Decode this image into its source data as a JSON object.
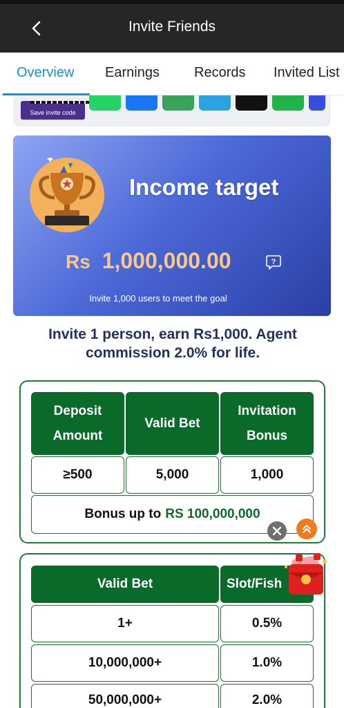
{
  "header": {
    "title": "Invite Friends"
  },
  "tabs": [
    {
      "label": "Overview",
      "active": true
    },
    {
      "label": "Earnings",
      "active": false
    },
    {
      "label": "Records",
      "active": false
    },
    {
      "label": "Invited List",
      "active": false
    }
  ],
  "share": {
    "save_code_label": "Save invite code",
    "buttons": [
      {
        "name": "whatsapp",
        "color": "#25d366"
      },
      {
        "name": "facebook",
        "color": "#1877f2"
      },
      {
        "name": "line",
        "color": "#3aa35a"
      },
      {
        "name": "telegram",
        "color": "#2aa3e0"
      },
      {
        "name": "x",
        "color": "#111111"
      },
      {
        "name": "message",
        "color": "#1fb34a"
      },
      {
        "name": "more",
        "color": "#3a4be0"
      }
    ]
  },
  "income": {
    "title": "Income target",
    "currency": "Rs",
    "amount": "1,000,000.00",
    "subtitle": "Invite 1,000 users to meet the goal"
  },
  "headline": "Invite 1 person, earn Rs1,000. Agent commission 2.0% for life.",
  "invite_table": {
    "headers": [
      "Deposit Amount",
      "Valid Bet",
      "Invitation Bonus"
    ],
    "row": [
      "≥500",
      "5,000",
      "1,000"
    ],
    "bonus_prefix": "Bonus up to",
    "bonus_value": "RS 100,000,000"
  },
  "commission_table": {
    "headers": [
      "Valid Bet",
      "Slot/Fish"
    ],
    "rows": [
      [
        "1+",
        "0.5%"
      ],
      [
        "10,000,000+",
        "1.0%"
      ],
      [
        "50,000,000+",
        "2.0%"
      ]
    ]
  },
  "colors": {
    "accent": "#1a8fcc",
    "table_green": "#0a6a2a",
    "gold": "#f7c98a"
  }
}
